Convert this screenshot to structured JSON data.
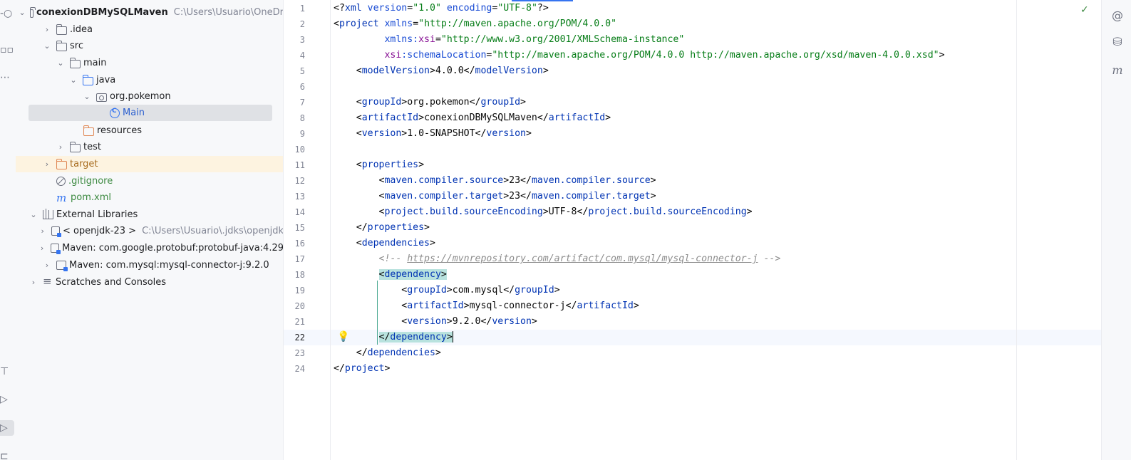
{
  "left_toolbar": {
    "icons": [
      "commit-icon",
      "structure-icon",
      "more-icon",
      "build-icon",
      "services-icon",
      "run-icon",
      "terminal-icon"
    ]
  },
  "project_tree": {
    "root": {
      "name": "conexionDBMySQLMaven",
      "path": "C:\\Users\\Usuario\\OneDr"
    },
    "items": [
      {
        "label": ".idea"
      },
      {
        "label": "src"
      },
      {
        "label": "main"
      },
      {
        "label": "java"
      },
      {
        "label": "org.pokemon"
      },
      {
        "label": "Main"
      },
      {
        "label": "resources"
      },
      {
        "label": "test"
      },
      {
        "label": "target"
      },
      {
        "label": ".gitignore"
      },
      {
        "label": "pom.xml"
      },
      {
        "label": "External Libraries"
      },
      {
        "label": "< openjdk-23 >",
        "hint": "C:\\Users\\Usuario\\.jdks\\openjdk"
      },
      {
        "label": "Maven: com.google.protobuf:protobuf-java:4.29"
      },
      {
        "label": "Maven: com.mysql:mysql-connector-j:9.2.0"
      },
      {
        "label": "Scratches and Consoles"
      }
    ]
  },
  "editor": {
    "line_numbers": [
      "1",
      "2",
      "3",
      "4",
      "5",
      "6",
      "7",
      "8",
      "9",
      "10",
      "11",
      "12",
      "13",
      "14",
      "15",
      "16",
      "17",
      "18",
      "19",
      "20",
      "21",
      "22",
      "23",
      "24"
    ],
    "current_line": "22",
    "xml": {
      "decl_open": "<?",
      "decl_name": "xml",
      "decl_attr1": "version",
      "decl_val1": "\"1.0\"",
      "decl_attr2": "encoding",
      "decl_val2": "\"UTF-8\"",
      "decl_close": "?>",
      "project": "project",
      "xmlns": "xmlns",
      "xmlns_val": "\"http://maven.apache.org/POM/4.0.0\"",
      "xmlns_xsi_prefix": "xmlns:",
      "xsi": "xsi",
      "xsi_val": "\"http://www.w3.org/2001/XMLSchema-instance\"",
      "schema_prefix": "xsi",
      "schema_attr": ":schemaLocation",
      "schema_val": "\"http://maven.apache.org/POM/4.0.0 http://maven.apache.org/xsd/maven-4.0.0.xsd\"",
      "modelVersion": "modelVersion",
      "modelVersion_val": "4.0.0",
      "groupId": "groupId",
      "groupId_val": "org.pokemon",
      "artifactId": "artifactId",
      "artifactId_val": "conexionDBMySQLMaven",
      "version": "version",
      "version_val": "1.0-SNAPSHOT",
      "properties": "properties",
      "mcs": "maven.compiler.source",
      "mcs_val": "23",
      "mct": "maven.compiler.target",
      "mct_val": "23",
      "pbse": "project.build.sourceEncoding",
      "pbse_val": "UTF-8",
      "dependencies": "dependencies",
      "comment_open": "<!-- ",
      "comment_url": "https://mvnrepository.com/artifact/com.mysql/mysql-connector-j",
      "comment_close": " -->",
      "dependency": "dependency",
      "dep_groupId_val": "com.mysql",
      "dep_artifactId_val": "mysql-connector-j",
      "dep_version_val": "9.2.0"
    }
  },
  "right_toolbar": {
    "icons": [
      "ai-assistant-icon",
      "database-icon",
      "maven-icon"
    ]
  }
}
